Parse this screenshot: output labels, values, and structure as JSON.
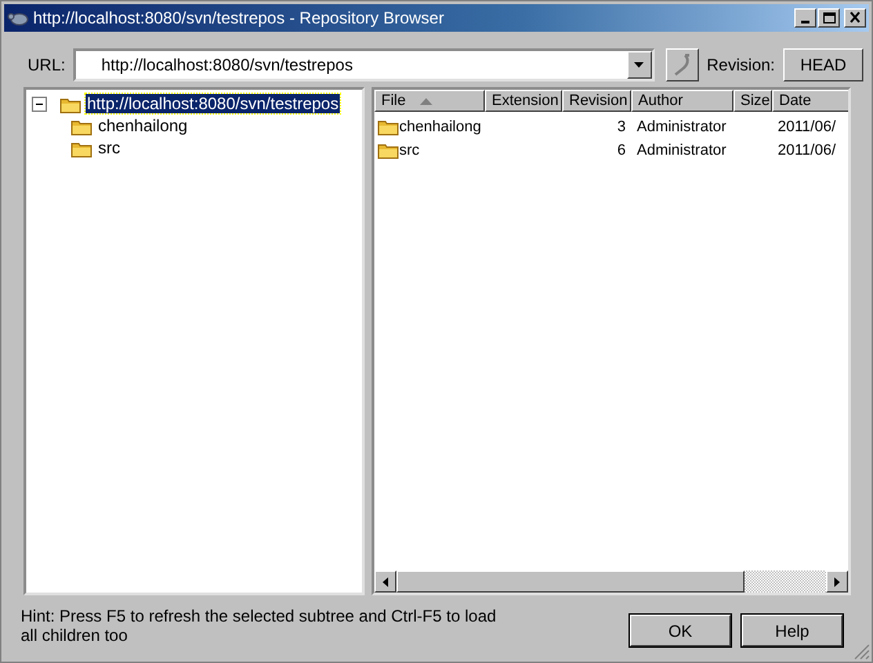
{
  "window": {
    "title": "http://localhost:8080/svn/testrepos - Repository Browser"
  },
  "url": {
    "label": "URL:",
    "value": "http://localhost:8080/svn/testrepos"
  },
  "revision": {
    "label": "Revision:",
    "button": "HEAD"
  },
  "tree": [
    {
      "label": "http://localhost:8080/svn/testrepos",
      "selected": true,
      "expanded": true,
      "children": [
        {
          "label": "chenhailong",
          "selected": false
        },
        {
          "label": "src",
          "selected": false
        }
      ]
    }
  ],
  "table": {
    "columns": [
      {
        "label": "File",
        "sorted": true
      },
      {
        "label": "Extension",
        "sorted": false
      },
      {
        "label": "Revision",
        "sorted": false
      },
      {
        "label": "Author",
        "sorted": false
      },
      {
        "label": "Size",
        "sorted": false
      },
      {
        "label": "Date",
        "sorted": false
      }
    ],
    "rows": [
      {
        "file": "chenhailong",
        "revision": "3",
        "author": "Administrator",
        "date": "2011/06/"
      },
      {
        "file": "src",
        "revision": "6",
        "author": "Administrator",
        "date": "2011/06/"
      }
    ]
  },
  "hint": "Hint: Press F5 to refresh the selected subtree and Ctrl-F5 to load all children too",
  "buttons": [
    "OK",
    "Help"
  ]
}
